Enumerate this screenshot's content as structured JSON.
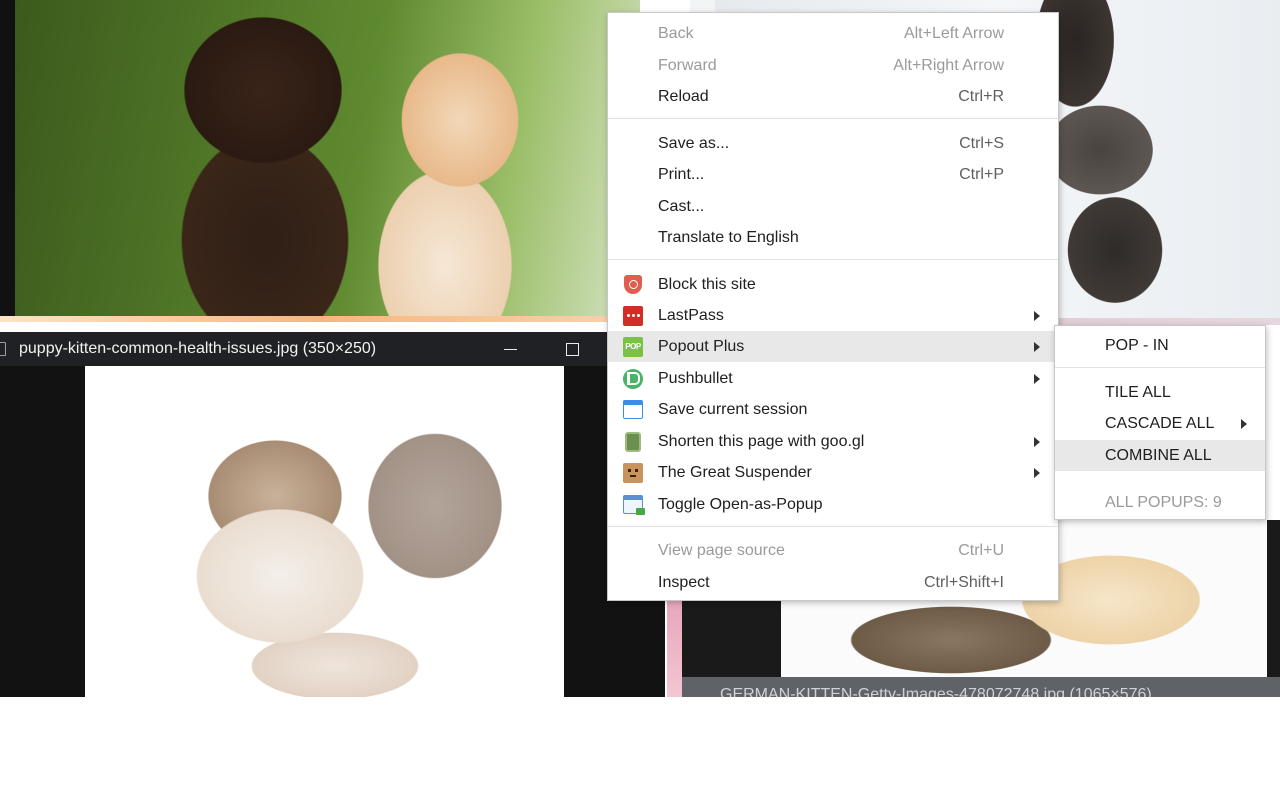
{
  "windows": {
    "bottom_left": {
      "title": "puppy-kitten-common-health-issues.jpg (350×250)"
    },
    "bottom_right": {
      "title": "GERMAN-KITTEN-Getty-Images-478072748.jpg (1065×576)"
    }
  },
  "context_menu": {
    "back": {
      "label": "Back",
      "shortcut": "Alt+Left Arrow"
    },
    "forward": {
      "label": "Forward",
      "shortcut": "Alt+Right Arrow"
    },
    "reload": {
      "label": "Reload",
      "shortcut": "Ctrl+R"
    },
    "save_as": {
      "label": "Save as...",
      "shortcut": "Ctrl+S"
    },
    "print": {
      "label": "Print...",
      "shortcut": "Ctrl+P"
    },
    "cast": {
      "label": "Cast..."
    },
    "translate": {
      "label": "Translate to English"
    },
    "extensions": [
      {
        "label": "Block this site",
        "icon": "block-site-icon"
      },
      {
        "label": "LastPass",
        "icon": "lastpass-icon"
      },
      {
        "label": "Popout Plus",
        "icon": "popout-plus-icon"
      },
      {
        "label": "Pushbullet",
        "icon": "pushbullet-icon"
      },
      {
        "label": "Save current session",
        "icon": "save-session-icon"
      },
      {
        "label": "Shorten this page with goo.gl",
        "icon": "googl-icon"
      },
      {
        "label": "The Great Suspender",
        "icon": "great-suspender-icon"
      },
      {
        "label": "Toggle Open-as-Popup",
        "icon": "open-as-popup-icon"
      }
    ],
    "view_source": {
      "label": "View page source",
      "shortcut": "Ctrl+U"
    },
    "inspect": {
      "label": "Inspect",
      "shortcut": "Ctrl+Shift+I"
    }
  },
  "popout_submenu": {
    "pop_in": "POP - IN",
    "tile_all": "TILE ALL",
    "cascade_all": "CASCADE ALL",
    "combine_all": "COMBINE ALL",
    "all_popups": "ALL POPUPS: 9"
  },
  "icons": {
    "popout_plus_text": "POP"
  }
}
